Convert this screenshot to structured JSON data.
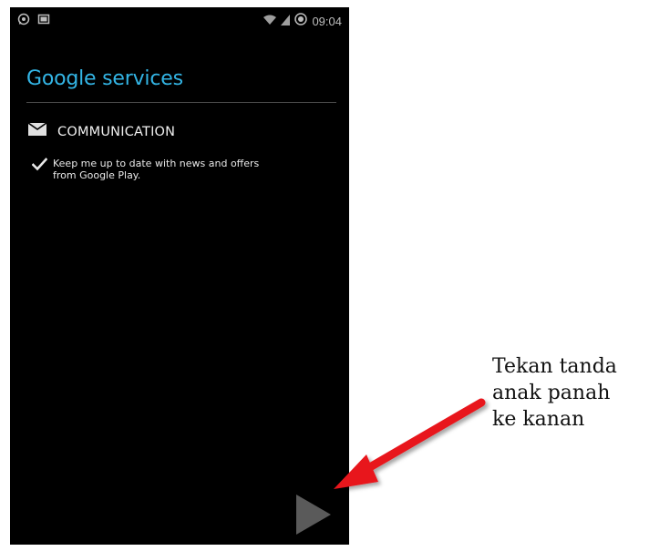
{
  "status_bar": {
    "left_icons": [
      "whatsapp-icon",
      "screenshot-icon"
    ],
    "right_icons": [
      "wifi-icon",
      "signal-icon",
      "data-sync-icon"
    ],
    "time": "09:04"
  },
  "screen": {
    "title": "Google services",
    "section": {
      "icon": "mail-icon",
      "label": "COMMUNICATION"
    },
    "option": {
      "checked": true,
      "line1": "Keep me up to date with news and offers",
      "line2": "from Google Play."
    },
    "next_button_icon": "play-arrow-icon"
  },
  "annotation": {
    "lines": [
      "Tekan tanda",
      "anak panah",
      "ke kanan"
    ],
    "arrow_color": "#e8141c"
  },
  "colors": {
    "title": "#33b5e5",
    "screen_bg": "#000000",
    "divider": "#4a4a4a"
  }
}
